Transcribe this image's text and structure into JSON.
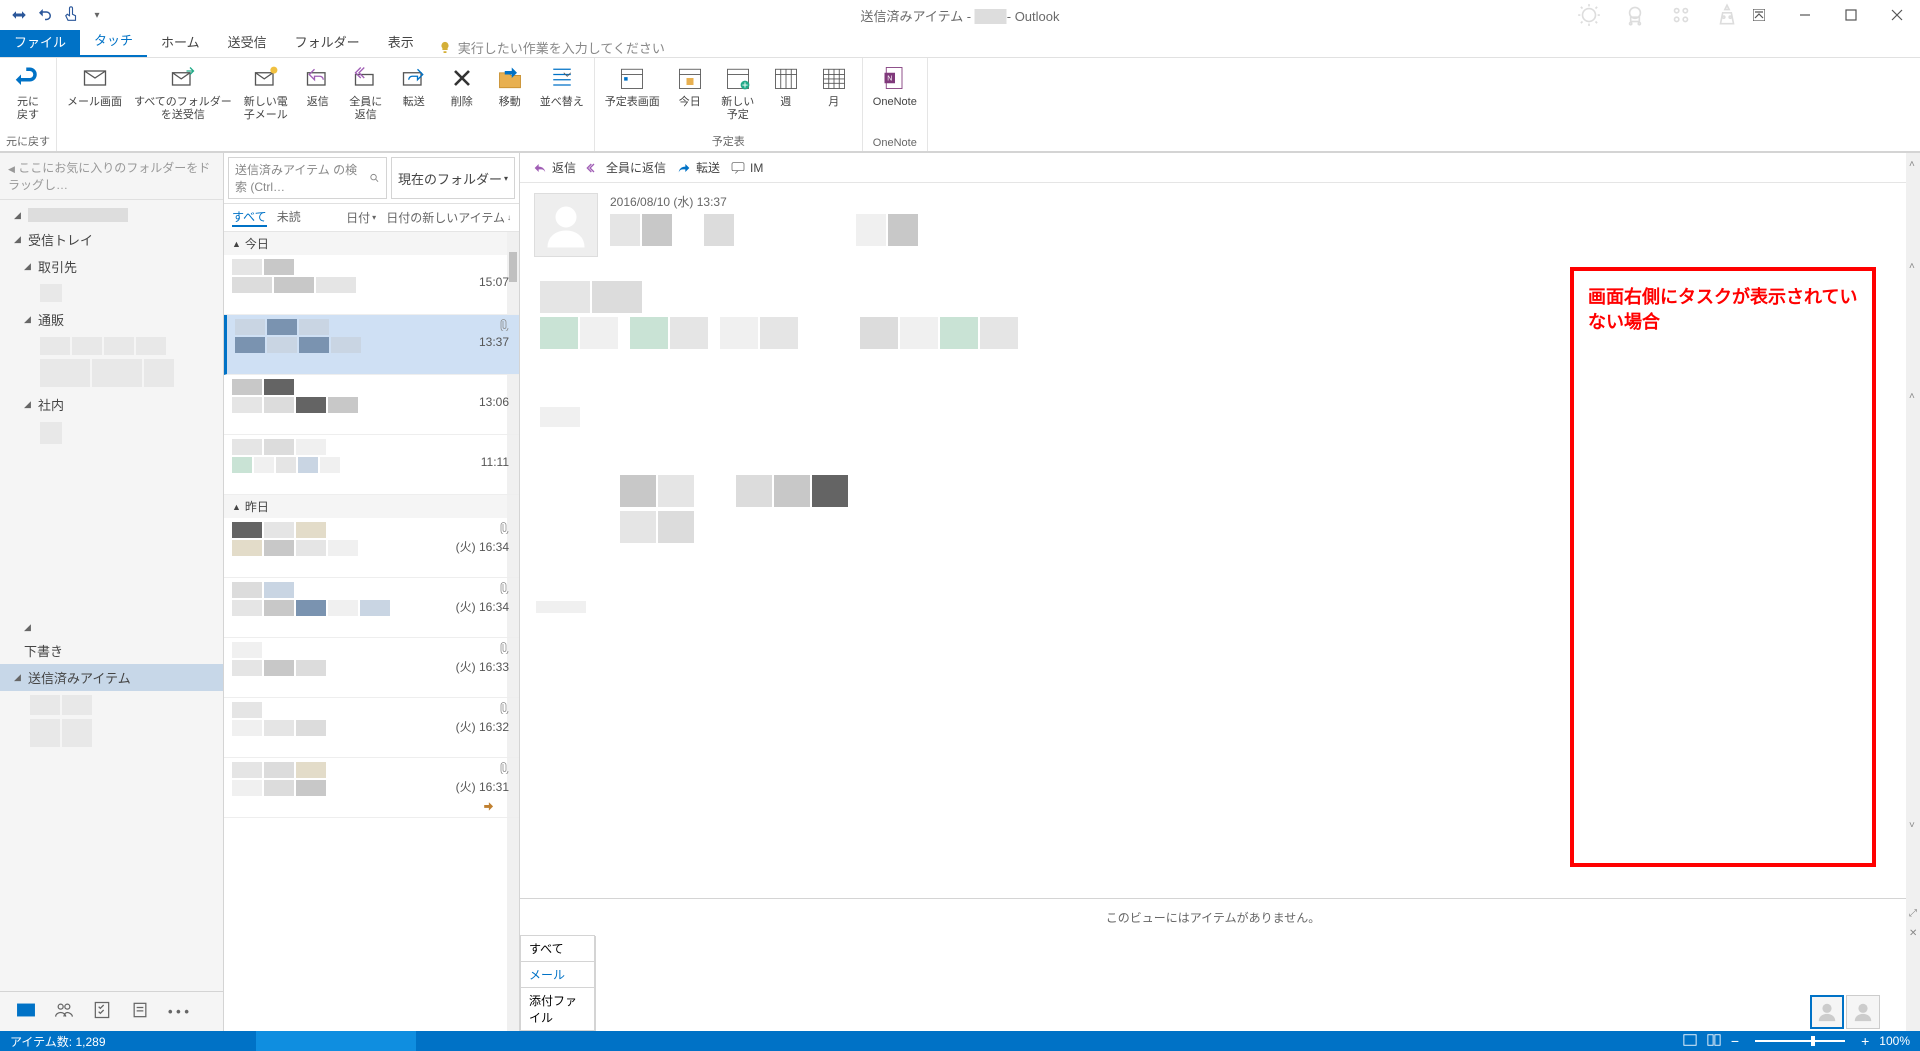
{
  "titlebar": {
    "title_left": "送信済みアイテム - ",
    "title_right": " - Outlook"
  },
  "ribbon_tabs": {
    "file": "ファイル",
    "touch": "タッチ",
    "home": "ホーム",
    "sendreceive": "送受信",
    "folder": "フォルダー",
    "view": "表示",
    "tell_me": "実行したい作業を入力してください"
  },
  "ribbon": {
    "undo": "元に\n戻す",
    "undo_group": "元に戻す",
    "mail_view": "メール画面",
    "all_folders_sr": "すべてのフォルダー\nを送受信",
    "new_email": "新しい電\n子メール",
    "reply": "返信",
    "reply_all": "全員に\n返信",
    "forward": "転送",
    "delete": "削除",
    "move": "移動",
    "sort": "並べ替え",
    "calendar_view": "予定表画面",
    "today": "今日",
    "new_appt": "新しい\n予定",
    "week": "週",
    "month": "月",
    "onenote": "OneNote",
    "calendar_group": "予定表",
    "onenote_group": "OneNote"
  },
  "folder_pane": {
    "favorites_hint": "ここにお気に入りのフォルダーをドラッグし…",
    "inbox": "受信トレイ",
    "torihikisaki": "取引先",
    "tsuhan": "通販",
    "shanai": "社内",
    "drafts": "下書き",
    "sent": "送信済みアイテム"
  },
  "msg_list": {
    "search_placeholder": "送信済みアイテム の検索 (Ctrl…",
    "scope": "現在のフォルダー",
    "filter_all": "すべて",
    "filter_unread": "未読",
    "sort_by": "日付",
    "sort_order": "日付の新しいアイテム",
    "today_header": "今日",
    "yesterday_header": "昨日",
    "items": [
      {
        "time": "15:07",
        "day": "",
        "attach": false,
        "selected": false
      },
      {
        "time": "13:37",
        "day": "",
        "attach": true,
        "selected": true
      },
      {
        "time": "13:06",
        "day": "",
        "attach": false,
        "selected": false
      },
      {
        "time": "11:11",
        "day": "",
        "attach": false,
        "selected": false
      },
      {
        "time": "16:34",
        "day": "(火)",
        "attach": true,
        "selected": false
      },
      {
        "time": "16:34",
        "day": "(火)",
        "attach": true,
        "selected": false
      },
      {
        "time": "16:33",
        "day": "(火)",
        "attach": true,
        "selected": false
      },
      {
        "time": "16:32",
        "day": "(火)",
        "attach": true,
        "selected": false
      },
      {
        "time": "16:31",
        "day": "(火)",
        "attach": true,
        "selected": false,
        "forwarded": true
      }
    ]
  },
  "reading": {
    "reply": "返信",
    "reply_all": "全員に返信",
    "forward": "転送",
    "im": "IM",
    "date": "2016/08/10 (水) 13:37",
    "no_items": "このビューにはアイテムがありません。",
    "tab_all": "すべて",
    "tab_mail": "メール",
    "tab_attach": "添付ファイル"
  },
  "annotation": {
    "text": "画面右側にタスクが表示されていない場合"
  },
  "statusbar": {
    "item_count": "アイテム数: 1,289",
    "zoom": "100%"
  }
}
